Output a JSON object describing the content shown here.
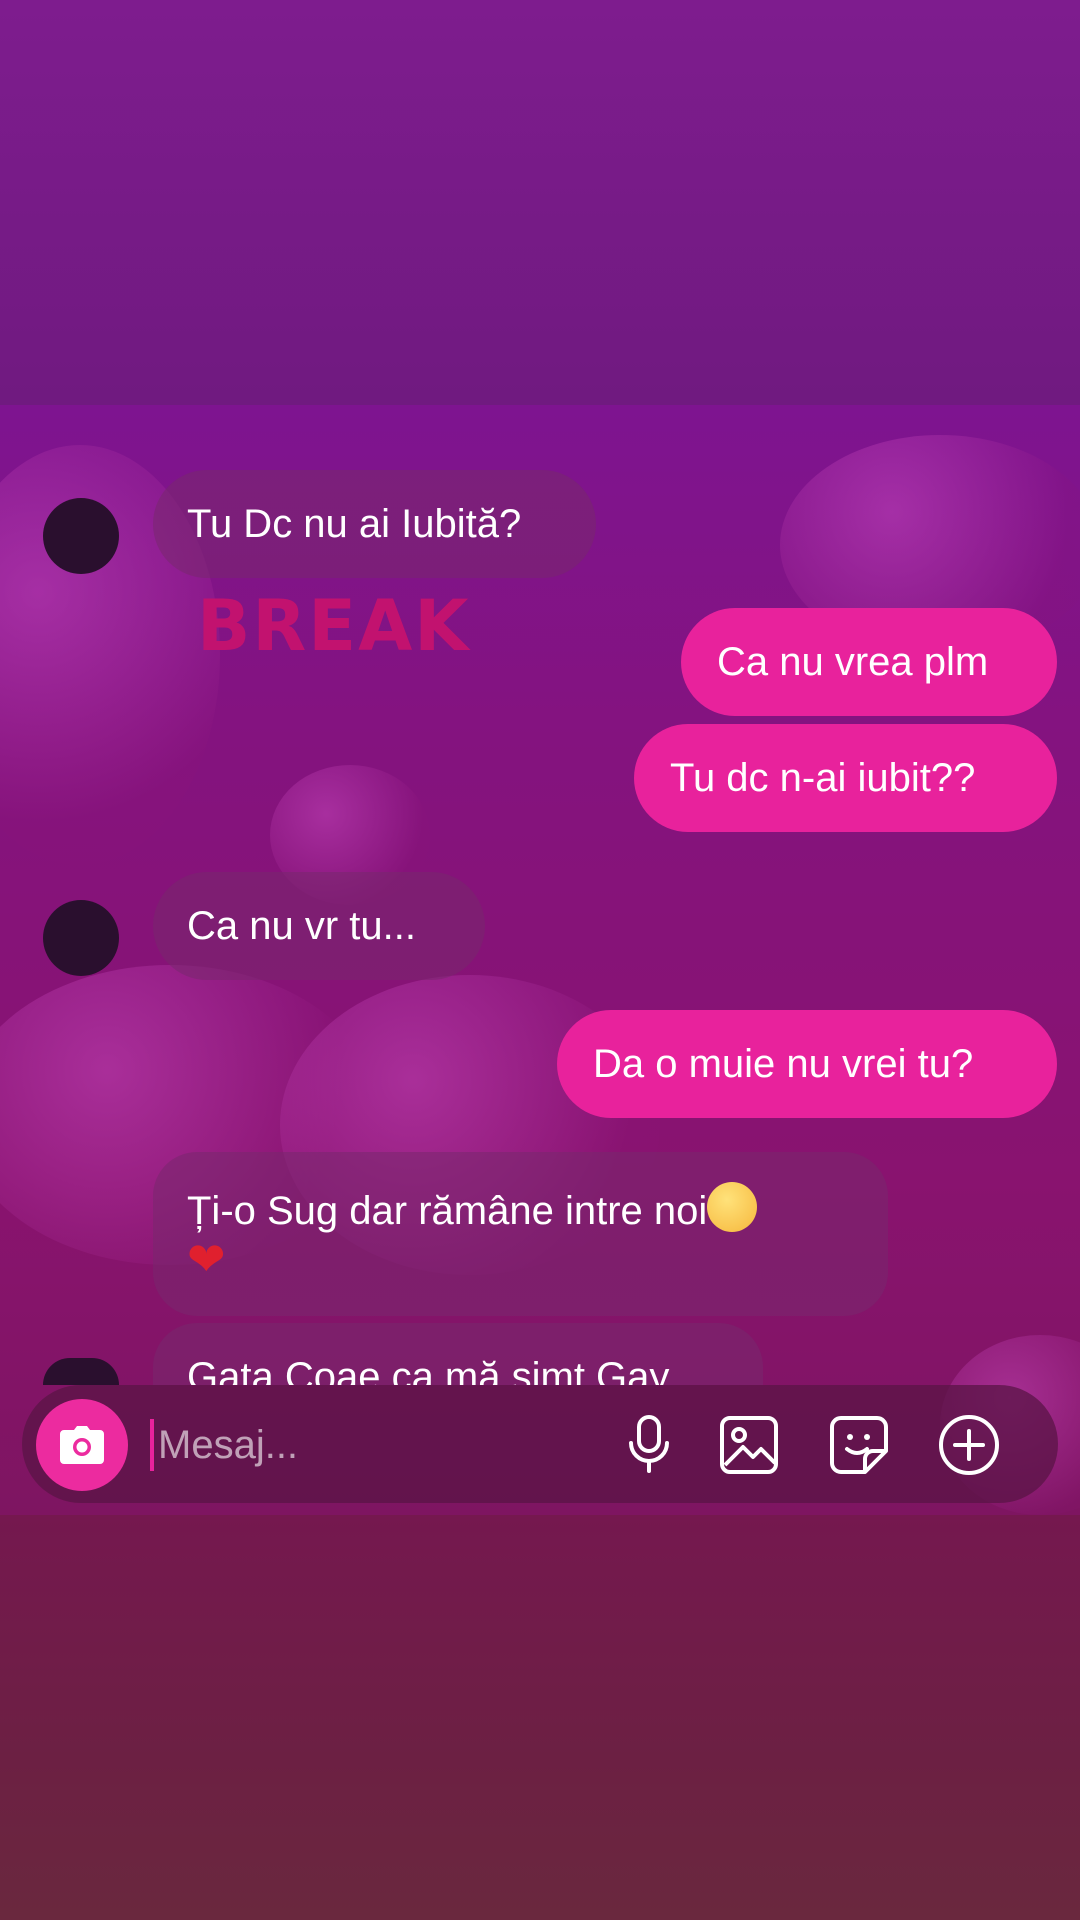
{
  "theme": {
    "accent": "#e8229c",
    "break_color": "#c2126f",
    "avatar_color": "#2a0f2e"
  },
  "chat": {
    "overlay_text": "BREAK",
    "messages": [
      {
        "side": "in",
        "text": "Tu Dc nu ai Iubită?"
      },
      {
        "side": "out",
        "text": "Ca nu vrea plm"
      },
      {
        "side": "out",
        "text": "Tu dc n-ai iubit??"
      },
      {
        "side": "in",
        "text": "Ca nu vr tu..."
      },
      {
        "side": "out",
        "text": "Da o muie nu vrei tu?"
      },
      {
        "side": "in",
        "text": "Ți-o Sug dar rămâne intre noi",
        "emojis": [
          "pleading-face",
          "red-heart"
        ]
      },
      {
        "side": "in",
        "text": "Gata Coae ca mă simt Gay"
      }
    ]
  },
  "composer": {
    "placeholder": "Mesaj...",
    "icons": [
      "camera-icon",
      "microphone-icon",
      "gallery-icon",
      "sticker-icon",
      "plus-icon"
    ]
  }
}
